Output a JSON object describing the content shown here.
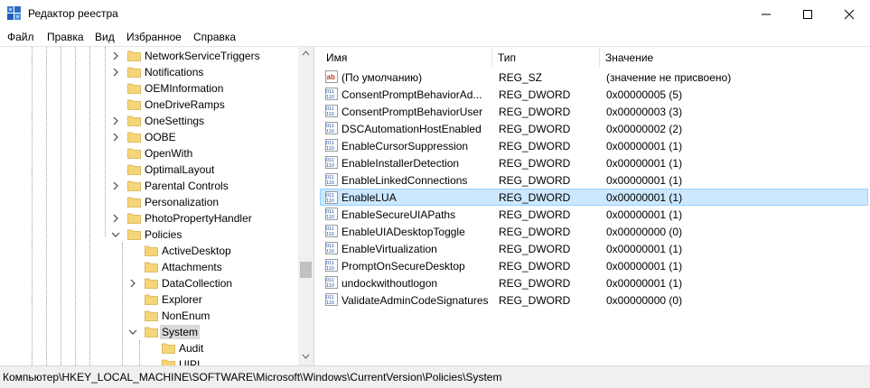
{
  "window": {
    "title": "Редактор реестра",
    "minimize_icon": "minimize-icon",
    "maximize_icon": "maximize-icon",
    "close_icon": "close-icon"
  },
  "menu": [
    "Файл",
    "Правка",
    "Вид",
    "Избранное",
    "Справка"
  ],
  "tree": [
    {
      "label": "NetworkServiceTriggers",
      "expander": "collapsed"
    },
    {
      "label": "Notifications",
      "expander": "collapsed"
    },
    {
      "label": "OEMInformation",
      "expander": "none"
    },
    {
      "label": "OneDriveRamps",
      "expander": "none"
    },
    {
      "label": "OneSettings",
      "expander": "collapsed"
    },
    {
      "label": "OOBE",
      "expander": "collapsed"
    },
    {
      "label": "OpenWith",
      "expander": "none"
    },
    {
      "label": "OptimalLayout",
      "expander": "none"
    },
    {
      "label": "Parental Controls",
      "expander": "collapsed"
    },
    {
      "label": "Personalization",
      "expander": "none"
    },
    {
      "label": "PhotoPropertyHandler",
      "expander": "collapsed"
    },
    {
      "label": "Policies",
      "expander": "expanded"
    },
    {
      "label": "ActiveDesktop",
      "expander": "none"
    },
    {
      "label": "Attachments",
      "expander": "none"
    },
    {
      "label": "DataCollection",
      "expander": "collapsed"
    },
    {
      "label": "Explorer",
      "expander": "none"
    },
    {
      "label": "NonEnum",
      "expander": "none"
    },
    {
      "label": "System",
      "expander": "expanded",
      "selected": true
    },
    {
      "label": "Audit",
      "expander": "none"
    },
    {
      "label": "UIPI",
      "expander": "none"
    }
  ],
  "columns": {
    "name": "Имя",
    "type": "Тип",
    "value": "Значение"
  },
  "values": [
    {
      "name": "(По умолчанию)",
      "type": "REG_SZ",
      "data": "(значение не присвоено)",
      "icon": "string-value-icon"
    },
    {
      "name": "ConsentPromptBehaviorAd...",
      "type": "REG_DWORD",
      "data": "0x00000005 (5)",
      "icon": "dword-value-icon"
    },
    {
      "name": "ConsentPromptBehaviorUser",
      "type": "REG_DWORD",
      "data": "0x00000003 (3)",
      "icon": "dword-value-icon"
    },
    {
      "name": "DSCAutomationHostEnabled",
      "type": "REG_DWORD",
      "data": "0x00000002 (2)",
      "icon": "dword-value-icon"
    },
    {
      "name": "EnableCursorSuppression",
      "type": "REG_DWORD",
      "data": "0x00000001 (1)",
      "icon": "dword-value-icon"
    },
    {
      "name": "EnableInstallerDetection",
      "type": "REG_DWORD",
      "data": "0x00000001 (1)",
      "icon": "dword-value-icon"
    },
    {
      "name": "EnableLinkedConnections",
      "type": "REG_DWORD",
      "data": "0x00000001 (1)",
      "icon": "dword-value-icon"
    },
    {
      "name": "EnableLUA",
      "type": "REG_DWORD",
      "data": "0x00000001 (1)",
      "icon": "dword-value-icon",
      "selected": true
    },
    {
      "name": "EnableSecureUIAPaths",
      "type": "REG_DWORD",
      "data": "0x00000001 (1)",
      "icon": "dword-value-icon"
    },
    {
      "name": "EnableUIADesktopToggle",
      "type": "REG_DWORD",
      "data": "0x00000000 (0)",
      "icon": "dword-value-icon"
    },
    {
      "name": "EnableVirtualization",
      "type": "REG_DWORD",
      "data": "0x00000001 (1)",
      "icon": "dword-value-icon"
    },
    {
      "name": "PromptOnSecureDesktop",
      "type": "REG_DWORD",
      "data": "0x00000001 (1)",
      "icon": "dword-value-icon"
    },
    {
      "name": "undockwithoutlogon",
      "type": "REG_DWORD",
      "data": "0x00000001 (1)",
      "icon": "dword-value-icon"
    },
    {
      "name": "ValidateAdminCodeSignatures",
      "type": "REG_DWORD",
      "data": "0x00000000 (0)",
      "icon": "dword-value-icon"
    }
  ],
  "status": {
    "path": "Компьютер\\HKEY_LOCAL_MACHINE\\SOFTWARE\\Microsoft\\Windows\\CurrentVersion\\Policies\\System"
  },
  "colors": {
    "selection": "#cce8ff",
    "selection_border": "#99d1ff",
    "folder": "#f5d57a"
  }
}
